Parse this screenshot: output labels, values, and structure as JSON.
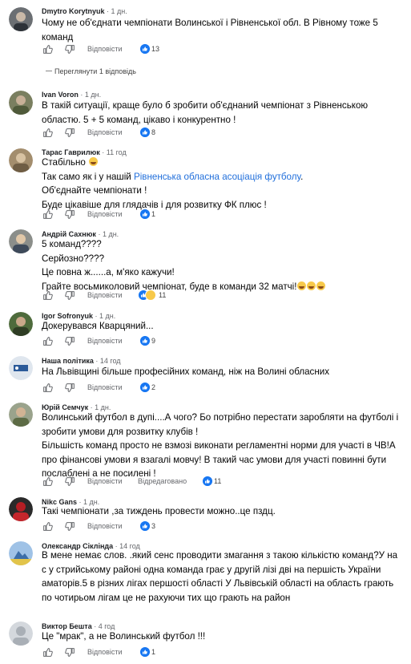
{
  "actions": {
    "reply_label": "Відповісти",
    "edited_label": "Відредаговано"
  },
  "comments": [
    {
      "author": "Dmytro Korytnyuk",
      "time": "1 дн.",
      "lines": [
        "Чому не об'єднати чемпіонати Волинської і Рівненської обл. В Рівному тоже 5",
        "команд"
      ],
      "likes": "13"
    },
    {
      "author": "Ivan Voron",
      "time": "1 дн.",
      "lines": [
        "В такій ситуації, краще було б зробити об'єднаний чемпіонат з Рівненською",
        "областю. 5 + 5 команд, цікаво і конкурентно !"
      ],
      "likes": "8"
    },
    {
      "author": "Тарас Гаврилюк",
      "time": "11 год",
      "lines": [
        "Стабільно",
        "Так само як і у нашій ",
        "Об'єднайте чемпіонати !",
        "Буде цікавіше для глядачів і для розвитку ФК плюс !"
      ],
      "mention": "Рівненська обласна асоціація футболу",
      "mention_suffix": ".",
      "likes": "1"
    },
    {
      "author": "Андрій Сахнюк",
      "time": "1 дн.",
      "lines": [
        "5 команд????",
        "Серйозно????",
        "Це повна ж......а, м'яко кажучи!",
        "Грайте восьмиколовий чемпіонат, буде в команди 32 матчі!"
      ],
      "likes": "11"
    },
    {
      "author": "Igor Sofronyuk",
      "time": "1 дн.",
      "lines": [
        "Докерувався Кварцяний..."
      ],
      "likes": "9"
    },
    {
      "author": "Наша політика",
      "time": "14 год",
      "lines": [
        "На Львівщині більше професійних команд, ніж на Волині обласних"
      ],
      "likes": "2"
    },
    {
      "author": "Юрій Семчук",
      "time": "1 дн.",
      "lines": [
        "Волинський футбол в дупі....А чого? Бо потрібно перестати заробляти на футболі і",
        "зробити умови для розвитку клубів !",
        "Більшість команд просто не взмозі виконати регламентні норми для участі в ЧВ!А",
        "про фінансові умови я взагалі мовчу! В такий час умови для участі повинні бути",
        "послаблені а не посилені !"
      ],
      "likes": "11"
    },
    {
      "author": "Nikc Gans",
      "time": "1 дн.",
      "lines": [
        "Такі чемпіонати ,за тиждень провести можно..це пздц."
      ],
      "likes": "3"
    },
    {
      "author": "Олександр Сіклінда",
      "time": "14 год",
      "lines": [
        "В мене немає слов. .який сенс проводити змагання з такою кількістю команд?У на",
        "с у стрийському районі одна команда грає у другій лізі дві на першість України",
        "аматорів.5 в різних лігах першості області У Львівській області на область грають",
        "по чотирьом лігам це не рахуючи тих що грають на район"
      ]
    },
    {
      "author": "Виктор Бешта",
      "time": "4 год",
      "lines": [
        "Це \"мрак\", а не Волинський футбол !!!"
      ],
      "likes": "1"
    }
  ],
  "view_replies_label": "Переглянути 1 відповідь"
}
